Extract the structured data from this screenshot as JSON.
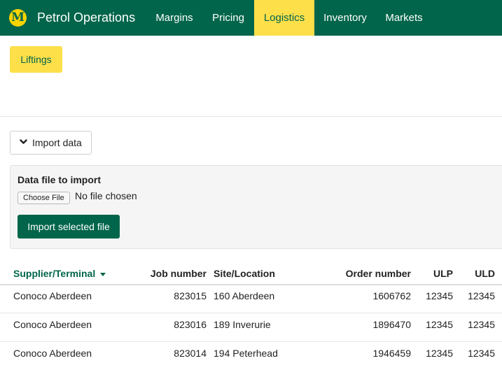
{
  "app": {
    "logo_letter": "M",
    "title": "Petrol Operations"
  },
  "nav": [
    "Margins",
    "Pricing",
    "Logistics",
    "Inventory",
    "Markets"
  ],
  "active_nav": "Logistics",
  "subnav": {
    "active": "Liftings"
  },
  "import": {
    "toggle_label": "Import data",
    "panel_title": "Data file to import",
    "choose_file_label": "Choose File",
    "no_file_text": "No file chosen",
    "submit_label": "Import selected file"
  },
  "table": {
    "headers": [
      "Supplier/Terminal",
      "Job number",
      "Site/Location",
      "Order number",
      "ULP",
      "ULD"
    ],
    "sorted_column": "Supplier/Terminal",
    "rows": [
      [
        "Conoco Aberdeen",
        "823015",
        "160 Aberdeen",
        "1606762",
        "12345",
        "12345"
      ],
      [
        "Conoco Aberdeen",
        "823016",
        "189 Inverurie",
        "1896470",
        "12345",
        "12345"
      ],
      [
        "Conoco Aberdeen",
        "823014",
        "194 Peterhead",
        "1946459",
        "12345",
        "12345"
      ]
    ]
  },
  "colors": {
    "brand_green": "#00654a",
    "brand_yellow": "#fddf4a"
  },
  "icons": {
    "import_toggle": "chevron-down-icon",
    "sort": "caret-down-icon"
  }
}
